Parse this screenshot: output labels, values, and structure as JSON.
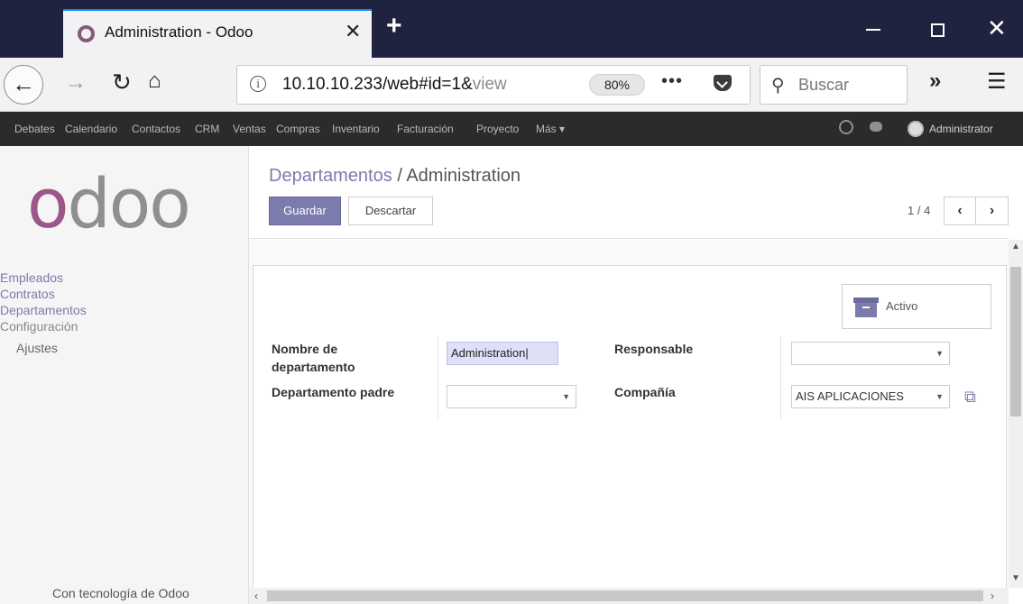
{
  "browser": {
    "tab_title": "Administration - Odoo",
    "url_main": "10.10.10.233/web#id=1&",
    "url_dim": "view",
    "zoom": "80%",
    "search_placeholder": "Buscar",
    "icons": [
      "back-arrow-icon",
      "forward-arrow-icon",
      "reload-icon",
      "home-icon",
      "info-icon",
      "page-actions-icon",
      "pocket-icon",
      "search-icon",
      "overflow-icon",
      "menu-icon"
    ]
  },
  "topmenu": {
    "items": [
      "Debates",
      "Calendario",
      "Contactos",
      "CRM",
      "Ventas",
      "Compras",
      "Inventario",
      "Facturación",
      "Proyecto",
      "Más"
    ],
    "user": "Administrator"
  },
  "sidebar": {
    "logo": "odoo",
    "links": [
      "Empleados",
      "Contratos",
      "Departamentos",
      "Configuración"
    ],
    "sub_items": [
      "Ajustes"
    ],
    "powered_by": "Con tecnología de Odoo"
  },
  "breadcrumb": {
    "parent": "Departamentos",
    "separator": "/",
    "current": "Administration"
  },
  "buttons": {
    "save": "Guardar",
    "discard": "Descartar",
    "active": "Activo"
  },
  "pager": {
    "value": "1 / 4"
  },
  "form": {
    "name_label_line1": "Nombre de",
    "name_label_line2": "departamento",
    "name_value": "Administration",
    "parent_label": "Departamento padre",
    "parent_value": "",
    "manager_label": "Responsable",
    "manager_value": "",
    "company_label": "Compañía",
    "company_value": "AIS APLICACIONES"
  },
  "colors": {
    "brand": "#7c7bad",
    "odoo_purple": "#875a7b",
    "menu_bg": "#2b2b2b",
    "titlebar_bg": "#202340"
  }
}
